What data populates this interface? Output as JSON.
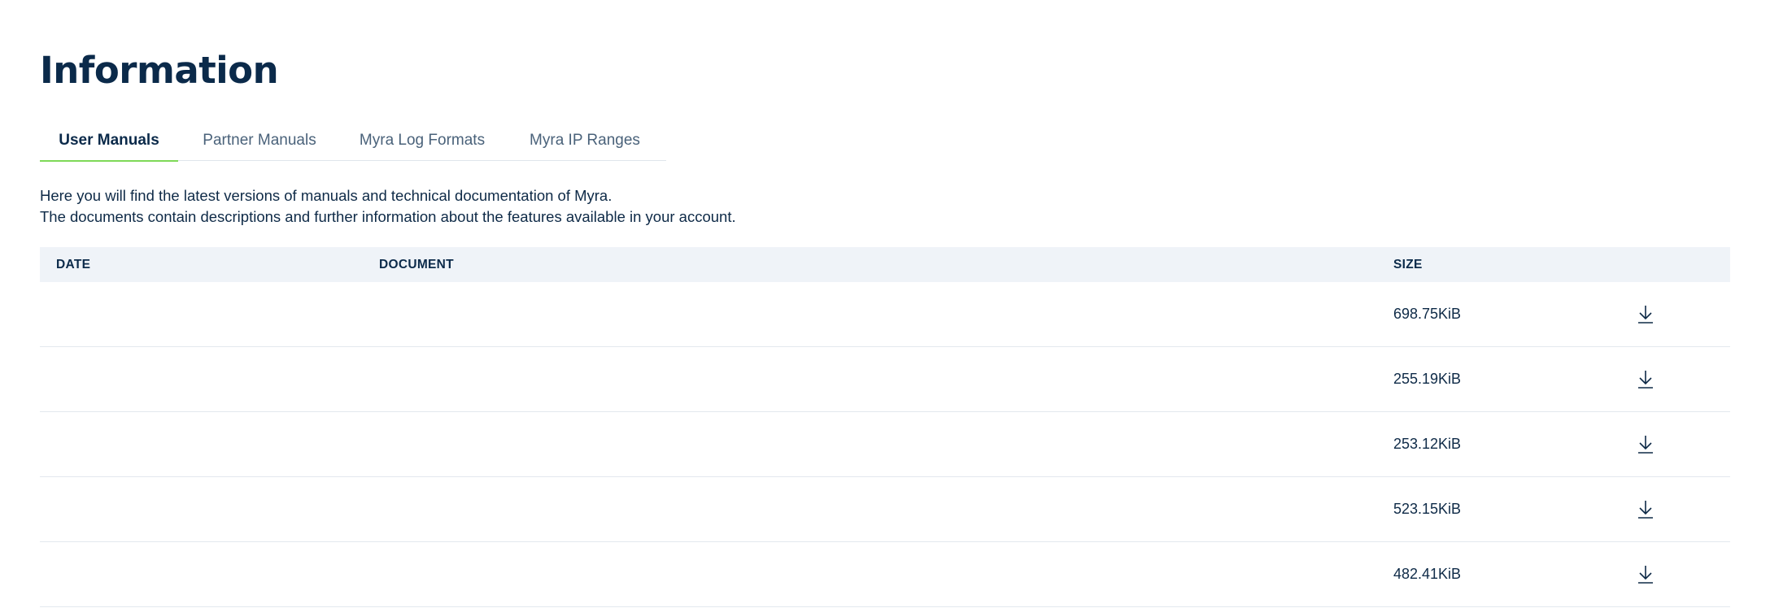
{
  "page": {
    "title": "Information"
  },
  "tabs": [
    {
      "label": "User Manuals",
      "active": true
    },
    {
      "label": "Partner Manuals",
      "active": false
    },
    {
      "label": "Myra Log Formats",
      "active": false
    },
    {
      "label": "Myra IP Ranges",
      "active": false
    }
  ],
  "intro": {
    "line1": "Here you will find the latest versions of manuals and technical documentation of Myra.",
    "line2": "The documents contain descriptions and further information about the features available in your account."
  },
  "table": {
    "headers": {
      "date": "DATE",
      "document": "DOCUMENT",
      "size": "SIZE"
    },
    "rows": [
      {
        "date": "",
        "document": "",
        "size": "698.75KiB",
        "action_icon": "download-icon"
      },
      {
        "date": "",
        "document": "",
        "size": "255.19KiB",
        "action_icon": "download-icon"
      },
      {
        "date": "",
        "document": "",
        "size": "253.12KiB",
        "action_icon": "download-icon"
      },
      {
        "date": "",
        "document": "",
        "size": "523.15KiB",
        "action_icon": "download-icon"
      },
      {
        "date": "",
        "document": "",
        "size": "482.41KiB",
        "action_icon": "download-icon"
      }
    ]
  },
  "colors": {
    "heading": "#0b2a4a",
    "text": "#0e2a47",
    "tab_inactive": "#4a627a",
    "tab_active_underline": "#7ed957",
    "table_header_bg": "#eff3f8",
    "row_divider": "#e3e8ee"
  }
}
